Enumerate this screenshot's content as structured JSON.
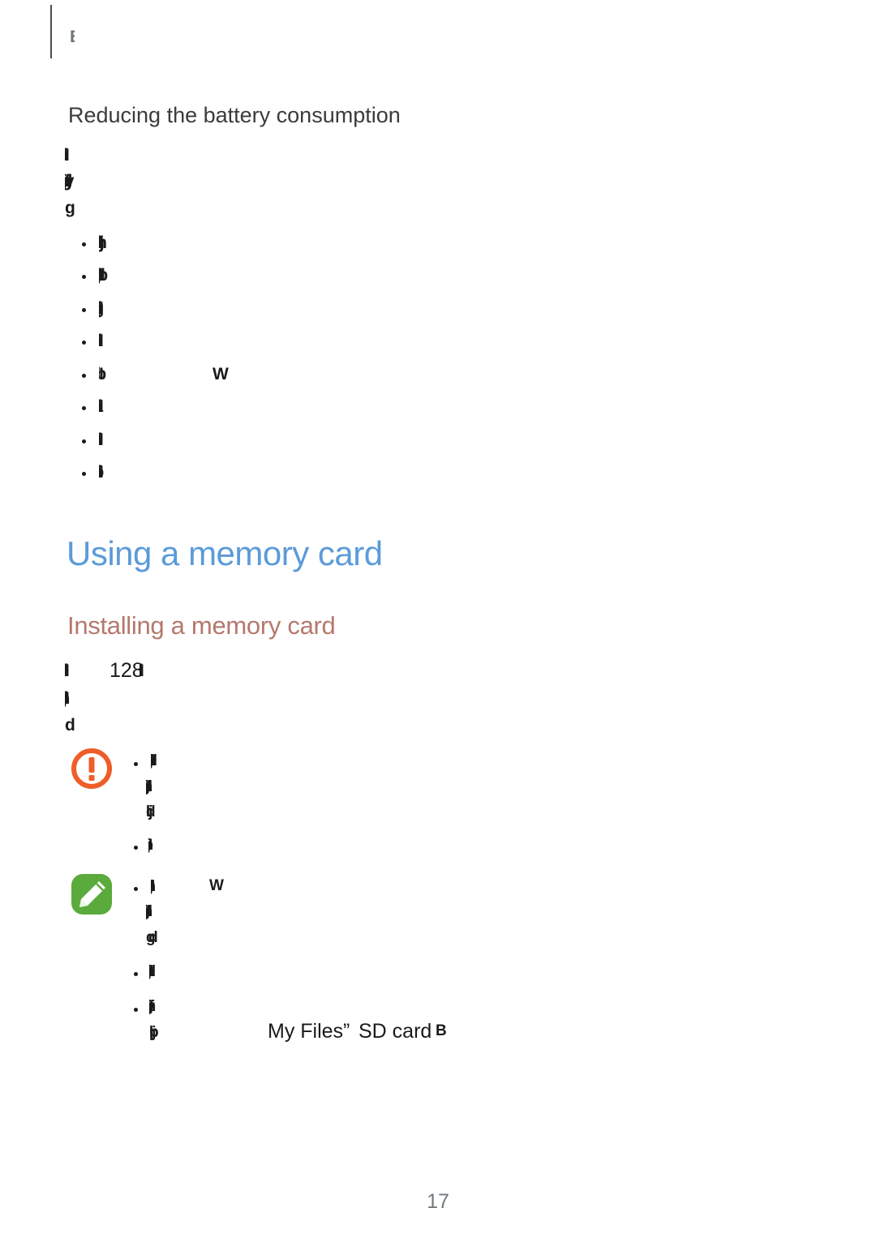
{
  "page": {
    "number": "17",
    "background_color": "#ffffff"
  },
  "header": {
    "running_head": "B",
    "rule_color": "#4c4c4c"
  },
  "sections": {
    "battery": {
      "heading": "Reducing the battery consumption",
      "heading_color": "#3b3b3b",
      "intro_lines": [
        "(degraded)",
        "(degraded)",
        "(degraded)"
      ],
      "bullets": [
        "(degraded)",
        "(degraded)",
        "(degraded)",
        "(degraded)",
        "(degraded)",
        "(degraded)",
        "(degraded)",
        "(degraded)"
      ],
      "bullet_trailing_fragment": "W"
    },
    "memory_card": {
      "chapter_heading": "Using a memory card",
      "chapter_heading_color": "#5b9bd8",
      "sub_heading": "Installing a memory card",
      "sub_heading_color": "#b5786d",
      "intro_lines": [
        "(degraded)",
        "(degraded)",
        "(degraded)"
      ],
      "intro_legible_fragment": "128",
      "warning": {
        "icon": "warning-icon",
        "icon_color": "#ef5d28",
        "bullets": [
          {
            "lines": [
              "(degraded)",
              "(degraded)",
              "(degraded)"
            ]
          },
          {
            "lines": [
              "(degraded)"
            ]
          }
        ]
      },
      "note": {
        "icon": "note-icon",
        "icon_color": "#5aaa3c",
        "bullets": [
          {
            "lines": [
              "(degraded)",
              "(degraded)",
              "(degraded)"
            ],
            "trailing_fragment": "W"
          },
          {
            "lines": [
              "(degraded)"
            ]
          },
          {
            "lines": [
              "(degraded)",
              "(degraded)"
            ],
            "legible_runs": [
              "My Files”",
              "SD card",
              "B"
            ]
          }
        ]
      }
    }
  },
  "glyph_runs": {
    "b1": "Ifjhjkjd",
    "b2": "Ijhgfjhdy",
    "b3": "g",
    "l1": "Ifghjn",
    "l2": "Ijfghjkjhdb",
    "l3": "Ifjhgjn",
    "l4": "Ifjh",
    "l5": "Ib",
    "l6": "Ifjha",
    "l7": "Ifjhjn",
    "l8": "Ifjhb",
    "frag_w": "W",
    "m1a": "Ifjhjkd",
    "m1b": "128",
    "m1c": "Ifjb",
    "m2": "Ijfghjkjd",
    "m3": "d",
    "w1a": "Ifjghjkjhd",
    "w1b": "Ijghfjkjhd",
    "w1c": "djl",
    "w2": "Ijfghjb",
    "n1a": "Ifjghjkjd",
    "n1b": "Ijghfjkjhd",
    "n1c": "gd",
    "n2": "Ifjghjkd",
    "n3a": "Ijghfjkjhy",
    "n3b": "pjb"
  },
  "legible_text": {
    "my_files": "My Files”",
    "sd_card": "SD card",
    "sd_card_suffix": "B"
  }
}
